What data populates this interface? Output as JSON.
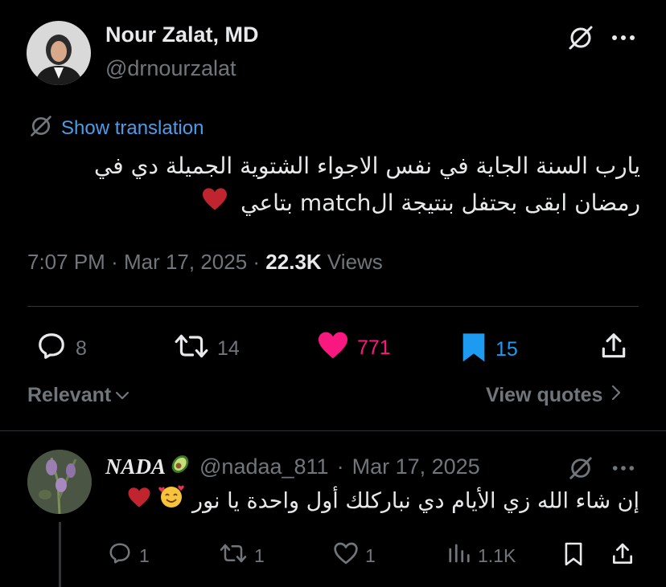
{
  "tweet": {
    "author_name": "Nour Zalat, MD",
    "author_handle": "@drnourzalat",
    "translate_label": "Show translation",
    "text_line1": "يارب السنة الجاية في نفس الاجواء الشتوية الجميلة دي في",
    "text_line2": "رمضان ابقى بحتفل بنتيجة الmatch بتاعي",
    "time": "7:07 PM",
    "date": "Mar 17, 2025",
    "views_count": "22.3K",
    "views_label": "Views",
    "replies": "8",
    "reposts": "14",
    "likes": "771",
    "bookmarks": "15"
  },
  "sort": {
    "label": "Relevant",
    "quotes_label": "View quotes"
  },
  "reply": {
    "name": "NADA",
    "handle": "@nadaa_811",
    "date": "Mar 17, 2025",
    "text": "إن شاء الله زي الأيام دي نباركلك أول واحدة يا نور",
    "replies": "1",
    "reposts": "1",
    "likes": "1",
    "views": "1.1K"
  },
  "colors": {
    "like_pink": "#f91880",
    "bookmark_blue": "#1d9bf0",
    "link_blue": "#4d9ce8",
    "muted": "#71767b"
  },
  "icons": [
    "grok-icon",
    "more-icon",
    "translate-icon",
    "reply-icon",
    "repost-icon",
    "like-icon",
    "bookmark-icon",
    "share-icon",
    "chevron-down-icon",
    "chevron-right-icon",
    "views-icon",
    "heart-emoji",
    "avocado-emoji",
    "smile-hearts-emoji"
  ]
}
